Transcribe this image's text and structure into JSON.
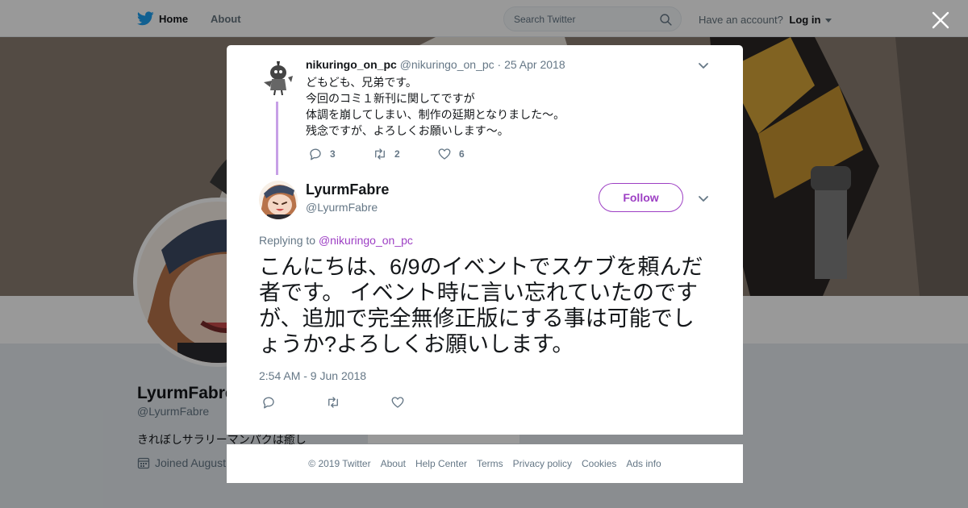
{
  "topbar": {
    "home_label": "Home",
    "about_label": "About",
    "search_placeholder": "Search Twitter",
    "have_account": "Have an account?",
    "login_label": "Log in"
  },
  "profile": {
    "name": "LyurmFabre",
    "handle": "@LyurmFabre",
    "bio": "きれぼしサラリーマンパクは癒し",
    "joined": "Joined August"
  },
  "parent_tweet": {
    "name": "nikuringo_on_pc",
    "handle": "@nikuringo_on_pc",
    "separator": "·",
    "date": "25 Apr 2018",
    "lines": [
      "どもども、兄弟です。",
      "今回のコミ１新刊に関してですが",
      "体調を崩してしまい、制作の延期となりました～。",
      "残念ですが、よろしくお願いします～。"
    ],
    "reply_count": "3",
    "retweet_count": "2",
    "like_count": "6"
  },
  "main_tweet": {
    "name": "LyurmFabre",
    "handle": "@LyurmFabre",
    "follow_label": "Follow",
    "replying_prefix": "Replying to",
    "replying_to": "@nikuringo_on_pc",
    "text": "こんにちは、6/9のイベントでスケブを頼んだ者です。 イベント時に言い忘れていたのですが、追加で完全無修正版にする事は可能でしょうか?よろしくお願いします。",
    "timestamp": "2:54 AM - 9 Jun 2018"
  },
  "footer": {
    "copyright": "© 2019 Twitter",
    "links": [
      "About",
      "Help Center",
      "Terms",
      "Privacy policy",
      "Cookies",
      "Ads info"
    ]
  },
  "background_ads_info": "Ads info",
  "colors": {
    "accent": "#9d3fc4",
    "thread_line": "#c7a0e6",
    "twitter_blue": "#1da1f2",
    "secondary_text": "#657786"
  }
}
